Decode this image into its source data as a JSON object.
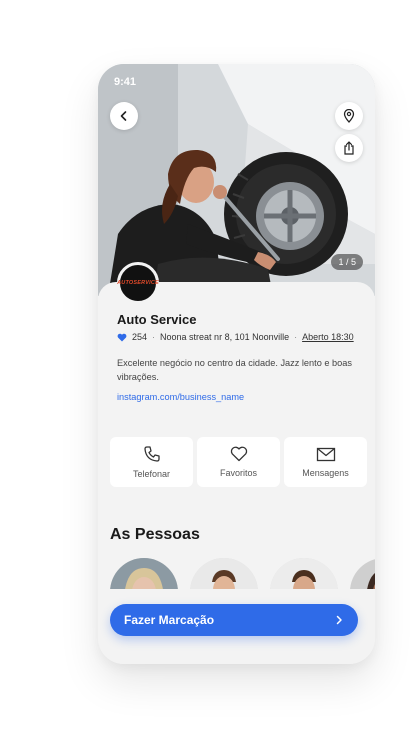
{
  "status": {
    "time": "9:41"
  },
  "gallery": {
    "counter": "1 / 5"
  },
  "business": {
    "logo_text": "AUTOSERVICE",
    "name": "Auto Service",
    "likes": "254",
    "address": "Noona streat nr 8, 101 Noonville",
    "hours": "Aberto 18:30",
    "description": "Excelente negócio no centro da cidade. Jazz lento e boas vibrações.",
    "instagram": "instagram.com/business_name"
  },
  "actions": [
    {
      "label": "Telefonar",
      "icon": "phone-icon"
    },
    {
      "label": "Favoritos",
      "icon": "heart-icon"
    },
    {
      "label": "Mensagens",
      "icon": "mail-icon"
    }
  ],
  "people": {
    "title": "As Pessoas"
  },
  "cta": {
    "label": "Fazer Marcação"
  },
  "colors": {
    "accent": "#2f6be8",
    "background": "#f3f3f3",
    "logo": "#e04a2a"
  }
}
